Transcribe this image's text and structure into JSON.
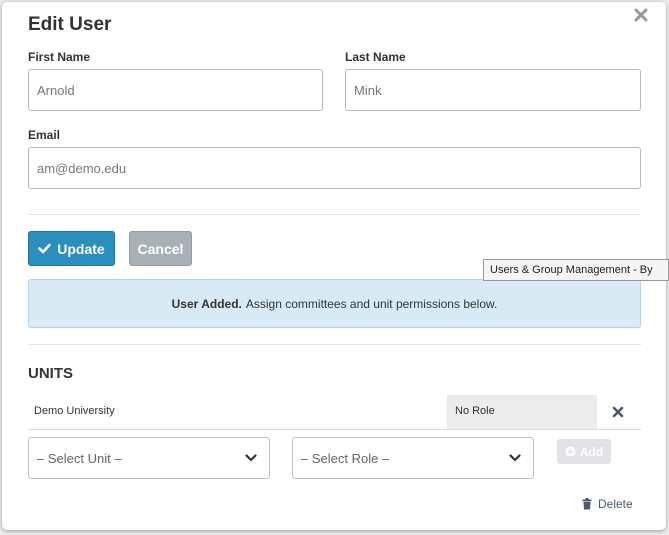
{
  "modal": {
    "title": "Edit User",
    "close_icon": "close-icon"
  },
  "form": {
    "first_name": {
      "label": "First Name",
      "value": "Arnold"
    },
    "last_name": {
      "label": "Last Name",
      "value": "Mink"
    },
    "email": {
      "label": "Email",
      "value": "am@demo.edu"
    }
  },
  "actions": {
    "update_label": "Update",
    "cancel_label": "Cancel",
    "update_color": "#2a8ebf",
    "cancel_color": "#a9b0b8"
  },
  "alert": {
    "bold_text": "User Added.",
    "text": "Assign committees and unit permissions below.",
    "color": "#d8ebf4"
  },
  "tooltip": {
    "text": "Users & Group Management - By"
  },
  "units": {
    "heading": "UNITS",
    "rows": [
      {
        "unit": "Demo University",
        "role": "No Role"
      }
    ],
    "select_unit_placeholder": "– Select Unit –",
    "select_role_placeholder": "– Select Role –",
    "add_label": "Add",
    "delete_label": "Delete"
  }
}
